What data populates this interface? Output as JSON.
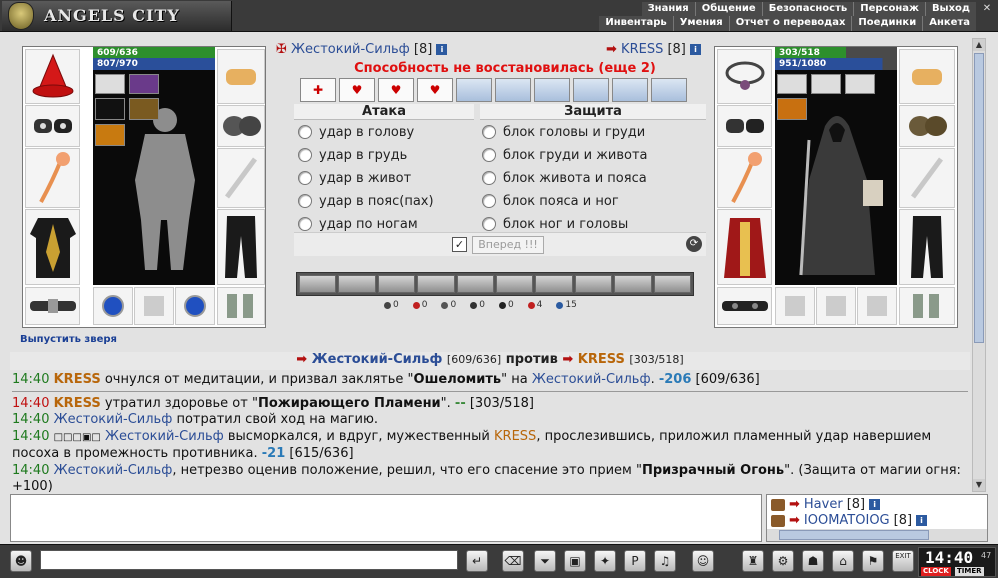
{
  "header": {
    "logo_text": "ANGELS CITY",
    "menu_row1": [
      "Знания",
      "Общение",
      "Безопасность",
      "Персонаж",
      "Выход"
    ],
    "menu_row2": [
      "Инвентарь",
      "Умения",
      "Отчет о переводах",
      "Поединки",
      "Анкета"
    ]
  },
  "player": {
    "name": "Жестокий-Сильф",
    "level": "[8]",
    "hp": "609/636",
    "mp": "807/970",
    "hp_fraction": 0.96,
    "mp_fraction": 0.83
  },
  "opponent": {
    "name": "KRESS",
    "level": "[8]",
    "hp": "303/518",
    "mp": "951/1080",
    "hp_fraction": 0.58,
    "mp_fraction": 0.88
  },
  "combat": {
    "notice": "Способность не восстановилась (еще 2)",
    "attack_header": "Атака",
    "defense_header": "Защита",
    "attacks": [
      "удар в голову",
      "удар в грудь",
      "удар в живот",
      "удар в пояс(пах)",
      "удар по ногам"
    ],
    "defenses": [
      "блок головы и груди",
      "блок груди и живота",
      "блок живота и пояса",
      "блок пояса и ног",
      "блок ног и головы"
    ],
    "forward_button": "Вперед !!!",
    "stats": [
      "0",
      "0",
      "0",
      "0",
      "0",
      "4",
      "15"
    ],
    "release_beast": "Выпустить зверя"
  },
  "vs": {
    "left_name": "Жестокий-Сильф",
    "left_hp": "[609/636]",
    "word": "против",
    "right_name": "KRESS",
    "right_hp": "[303/518]"
  },
  "log": {
    "l1": {
      "time": "14:40",
      "name": "KRESS",
      "text1": " очнулся от медитации, и призвал заклятье \"",
      "spell": "Ошеломить",
      "text2": "\" на ",
      "target": "Жестокий-Сильф",
      "dmg": "-206",
      "hp": "[609/636]"
    },
    "l2": {
      "time": "14:40",
      "name": "KRESS",
      "text1": " утратил здоровье от \"",
      "spell": "Пожирающего Пламени",
      "text2": "\". ",
      "dmg": "--",
      "hp": "[303/518]"
    },
    "l3": {
      "time": "14:40",
      "name": "Жестокий-Сильф",
      "text": " потратил свой ход на магию."
    },
    "l4": {
      "time": "14:40",
      "name": "Жестокий-Сильф",
      "text1": " высморкался, и вдруг, мужественный ",
      "name2": "KRESS",
      "text2": ", прослезившись, приложил пламенный удар навершием посоха в промежность противника. ",
      "dmg": "-21",
      "hp": "[615/636]"
    },
    "l5": {
      "time": "14:40",
      "name": "Жестокий-Сильф",
      "text1": ", нетрезво оценив положение, решил, что его спасение это прием \"",
      "spell": "Призрачный Огонь",
      "text2": "\". (Защита от магии огня: +100)"
    }
  },
  "online": [
    {
      "name": "Haver",
      "level": "[8]"
    },
    {
      "name": "IOOMATOIOG",
      "level": "[8]"
    }
  ],
  "clock": {
    "time": "14:40",
    "seconds": "47",
    "clock_label": "CLOCK",
    "timer_label": "TIMER"
  },
  "bottom": {
    "exit_label": "EXIT"
  },
  "colors": {
    "player_nick": "#2b4d96",
    "opponent_nick": "#b8660a",
    "notice": "#e01010"
  }
}
